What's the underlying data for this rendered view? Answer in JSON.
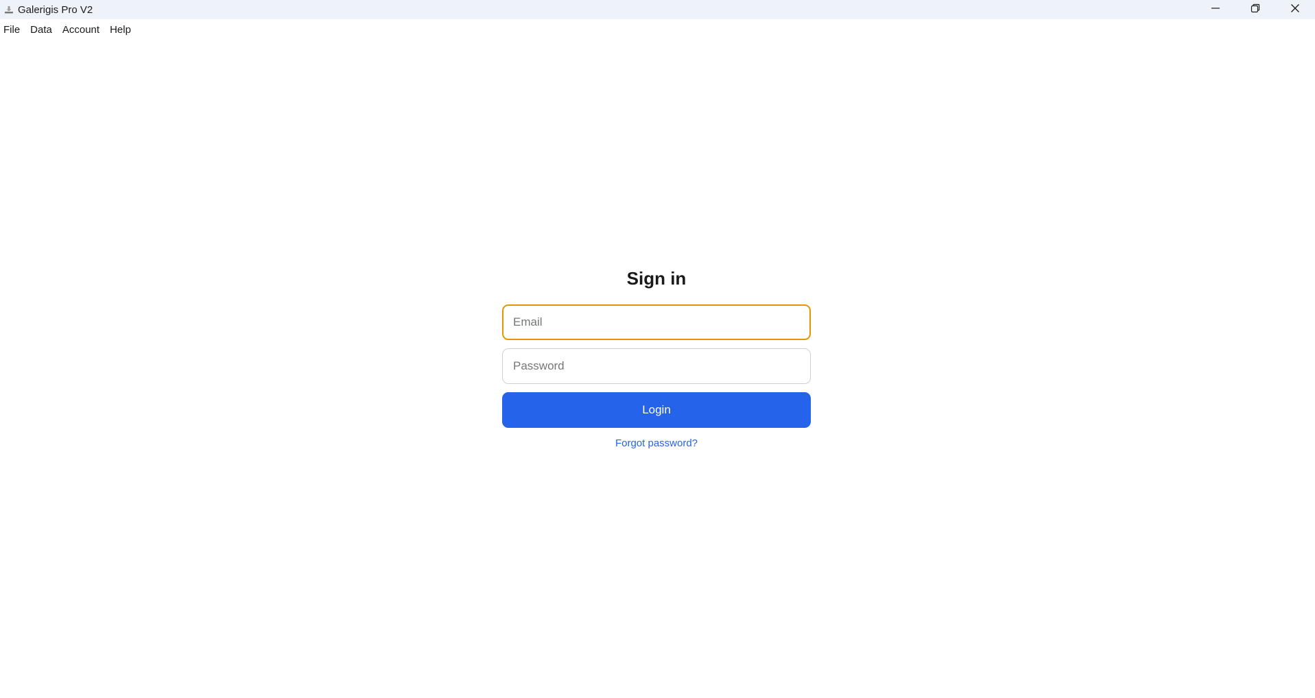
{
  "window": {
    "title": "Galerigis Pro V2",
    "app_icon": "download-tray-icon",
    "controls": [
      "minimize-icon",
      "restore-icon",
      "close-icon"
    ]
  },
  "menu": {
    "items": [
      "File",
      "Data",
      "Account",
      "Help"
    ]
  },
  "signin": {
    "heading": "Sign in",
    "email_placeholder": "Email",
    "email_value": "",
    "password_placeholder": "Password",
    "password_value": "",
    "login_label": "Login",
    "forgot_label": "Forgot password?"
  },
  "colors": {
    "titlebar_bg": "#eef3f9",
    "accent_blue": "#2563eb",
    "focus_orange": "#e69500"
  }
}
